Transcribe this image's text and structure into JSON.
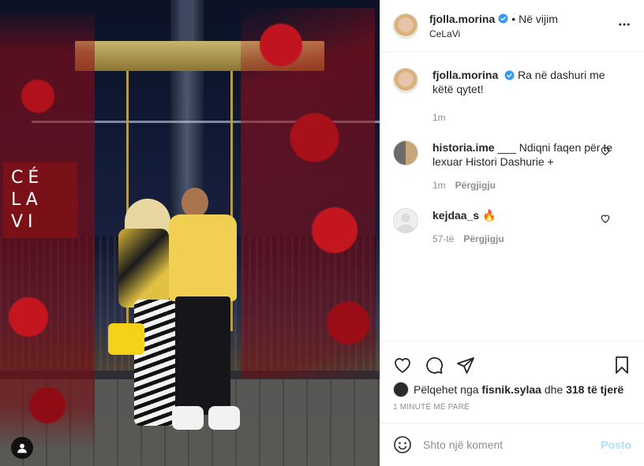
{
  "photo": {
    "sign_lines": [
      "CÉ",
      "LA",
      "VI"
    ],
    "alt": ""
  },
  "header": {
    "username": "fjolla.morina",
    "separator": "•",
    "follow_label": "Në vijim",
    "location": "CeLaVi"
  },
  "caption": {
    "username": "fjolla.morina",
    "text": "Ra në dashuri me këtë qytet!",
    "time": "1m"
  },
  "comments": [
    {
      "username": "historia.ime",
      "text": "___ Ndiqni faqen për te lexuar Histori Dashurie +",
      "time": "1m",
      "reply_label": "Përgjigju"
    },
    {
      "username": "kejdaa_s",
      "text": "🔥",
      "time": "57-të",
      "reply_label": "Përgjigju"
    }
  ],
  "likes": {
    "prefix": "Pëlqehet nga",
    "user": "fisnik.sylaa",
    "joiner": "dhe",
    "others": "318 të tjerë"
  },
  "timestamp": "1 minutë më parë",
  "add_comment": {
    "placeholder": "Shto një koment",
    "post_label": "Posto"
  },
  "colors": {
    "verified": "#3897f0",
    "post_button_disabled": "#b2dffc",
    "secondary_text": "#8e8e8e"
  }
}
